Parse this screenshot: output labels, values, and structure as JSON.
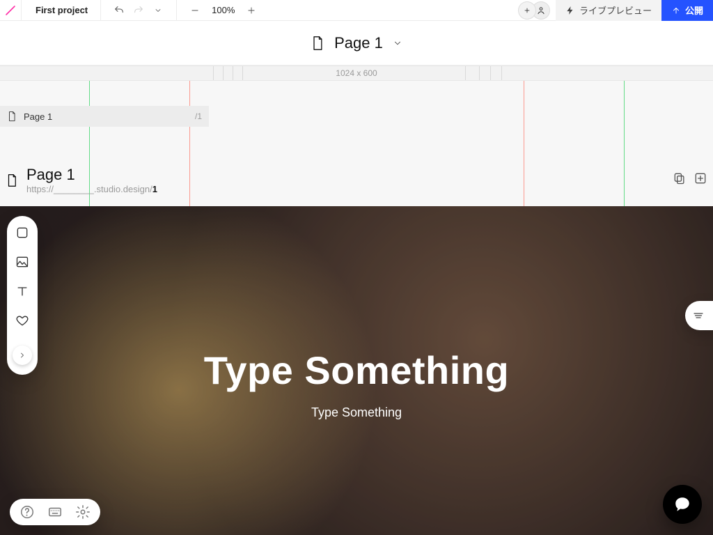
{
  "topbar": {
    "project_name": "First project",
    "zoom_label": "100%",
    "preview_label": "ライブプレビュー",
    "publish_label": "公開"
  },
  "pagebar": {
    "page_label": "Page 1"
  },
  "canvas_header": {
    "dims_label": "1024 x 600"
  },
  "crumb": {
    "label": "Page 1",
    "index": "/1"
  },
  "page_meta": {
    "title": "Page 1",
    "url_prefix": "https://________.studio.design/",
    "url_slug": "1"
  },
  "hero": {
    "heading": "Type Something",
    "sub": "Type Something"
  },
  "left_tools": {
    "items": [
      "box",
      "image",
      "text",
      "favorite"
    ]
  },
  "bottom_tools": {
    "items": [
      "help",
      "keyboard",
      "settings"
    ]
  },
  "colors": {
    "accent": "#2453ff",
    "logo": "#ff2ea6"
  }
}
